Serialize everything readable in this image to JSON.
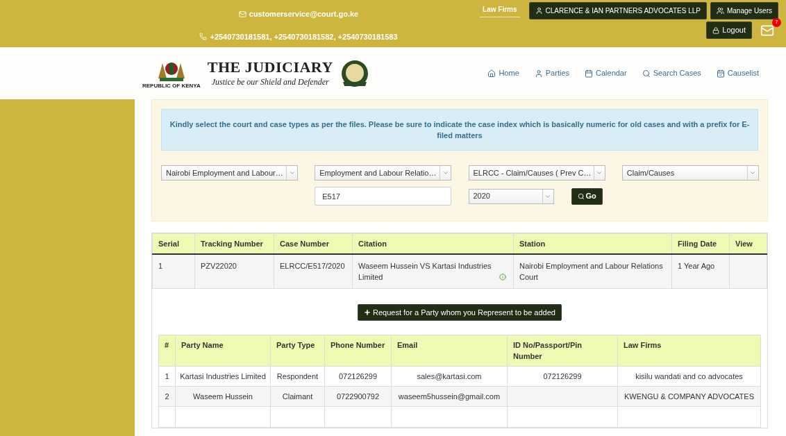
{
  "top_bar": {
    "email": "customerservice@court.go.ke",
    "phones": "+2540730181581, +2540730181582, +2540730181583",
    "law_firms_link": "Law Firms",
    "account_button": "CLARENCE & IAN PARTNERS ADVOCATES LLP",
    "manage_users_button": "Manage Users",
    "logout_button": "Logout",
    "message_count": "7"
  },
  "header": {
    "title": "THE JUDICIARY",
    "tagline": "Justice be our Shield and Defender",
    "emblem_caption": "REPUBLIC OF KENYA",
    "nav": [
      {
        "label": "Home",
        "kind": "home"
      },
      {
        "label": "Parties",
        "kind": "user"
      },
      {
        "label": "Calendar",
        "kind": "calendar"
      },
      {
        "label": "Search Cases",
        "kind": "search"
      },
      {
        "label": "Causelist",
        "kind": "list"
      }
    ]
  },
  "notice": "Kindly select the court and case types as per the files. Please be sure to indicate the case index which is basically numeric for old cases and with a prefix for E-filed matters",
  "filters": {
    "court": "Nairobi Employment and Labour…",
    "division": "Employment and Labour Relatio…",
    "case_type": "ELRCC - Claim/Causes ( Prev C…",
    "category": "Claim/Causes",
    "case_index": "E517",
    "year": "2020",
    "go_button": "Go"
  },
  "cases_table": {
    "columns": [
      "Serial",
      "Tracking Number",
      "Case Number",
      "Citation",
      "Station",
      "Filing Date",
      "View"
    ],
    "rows": [
      {
        "serial": "1",
        "tracking_number": "PZV22020",
        "case_number": "ELRCC/E517/2020",
        "citation": "Waseem Hussein VS Kartasi Industries Limited",
        "station": "Nairobi Employment and Labour Relations Court",
        "filing_date": "1 Year Ago"
      }
    ]
  },
  "request_button": "Request for a Party whom you Represent to be added",
  "parties_table": {
    "columns": [
      "#",
      "Party Name",
      "Party Type",
      "Phone Number",
      "Email",
      "ID No/Passport/Pin Number",
      "Law Firms"
    ],
    "rows": [
      [
        "1",
        "Kartasi Industries Limited",
        "Respondent",
        "072126299",
        "sales@kartasi.com",
        "072126299",
        "kisilu wandati and co advocates"
      ],
      [
        "2",
        "Waseem Hussein",
        "Claimant",
        "0722900792",
        "waseem5hussein@gmail.com",
        "",
        "KWENGU & COMPANY ADVOCATES"
      ]
    ]
  }
}
